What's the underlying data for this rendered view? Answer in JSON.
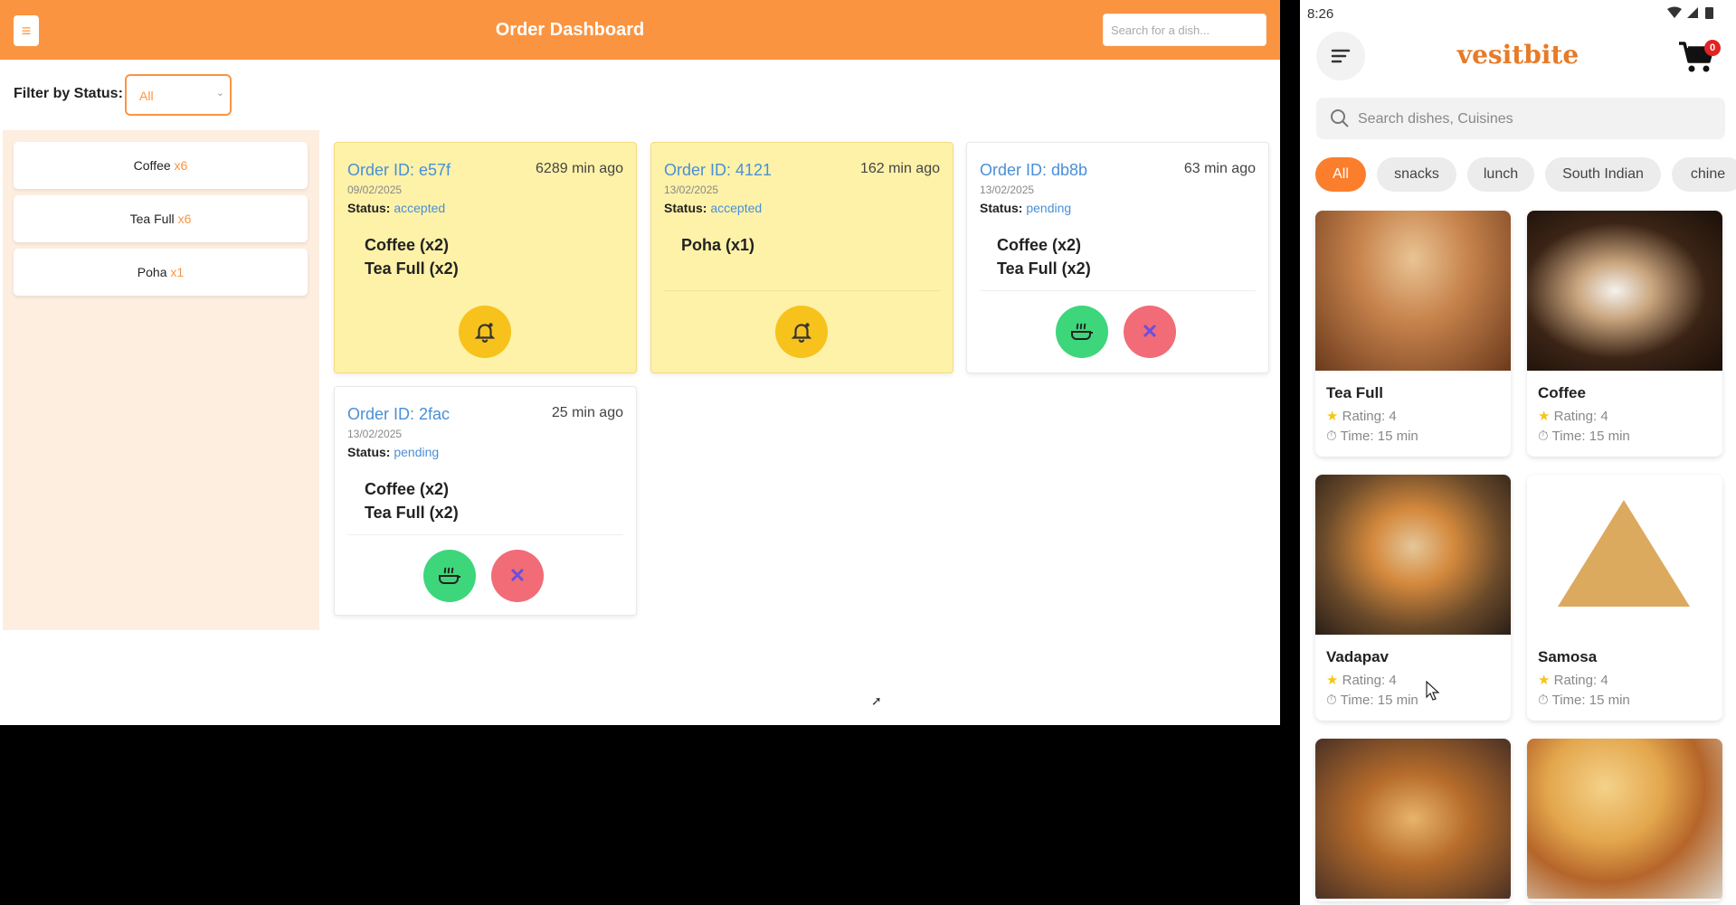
{
  "dashboard": {
    "title": "Order Dashboard",
    "menu_icon": "≡",
    "search_placeholder": "Search for a dish...",
    "filter_label": "Filter by Status:",
    "filter_value": "All",
    "summary": [
      {
        "name": "Coffee",
        "qty": "x6"
      },
      {
        "name": "Tea Full",
        "qty": "x6"
      },
      {
        "name": "Poha",
        "qty": "x1"
      }
    ],
    "orders": [
      {
        "id": "Order ID: e57f",
        "ago": "6289 min ago",
        "date": "09/02/2025",
        "status_label": "Status:",
        "status": "accepted",
        "items": [
          "Coffee (x2)",
          "Tea Full (x2)"
        ]
      },
      {
        "id": "Order ID: 4121",
        "ago": "162 min ago",
        "date": "13/02/2025",
        "status_label": "Status:",
        "status": "accepted",
        "items": [
          "Poha (x1)"
        ]
      },
      {
        "id": "Order ID: db8b",
        "ago": "63 min ago",
        "date": "13/02/2025",
        "status_label": "Status:",
        "status": "pending",
        "items": [
          "Coffee (x2)",
          "Tea Full (x2)"
        ]
      },
      {
        "id": "Order ID: 2fac",
        "ago": "25 min ago",
        "date": "13/02/2025",
        "status_label": "Status:",
        "status": "pending",
        "items": [
          "Coffee (x2)",
          "Tea Full (x2)"
        ]
      }
    ],
    "colors": {
      "accent": "#fb9440",
      "accepted_bg": "#fdf2a8",
      "link": "#4a8fd6"
    }
  },
  "phone": {
    "time": "8:26",
    "logo": "vesitbite",
    "cart_count": "0",
    "search_placeholder": "Search dishes, Cuisines",
    "chips": [
      "All",
      "snacks",
      "lunch",
      "South Indian",
      "chine"
    ],
    "foods": [
      {
        "name": "Tea Full",
        "rating": "Rating: 4",
        "time": "Time: 15 min"
      },
      {
        "name": "Coffee",
        "rating": "Rating: 4",
        "time": "Time: 15 min"
      },
      {
        "name": "Vadapav",
        "rating": "Rating: 4",
        "time": "Time: 15 min"
      },
      {
        "name": "Samosa",
        "rating": "Rating: 4",
        "time": "Time: 15 min"
      }
    ],
    "colors": {
      "brand": "#e77b28",
      "chip_active": "#fb7e2c"
    }
  }
}
